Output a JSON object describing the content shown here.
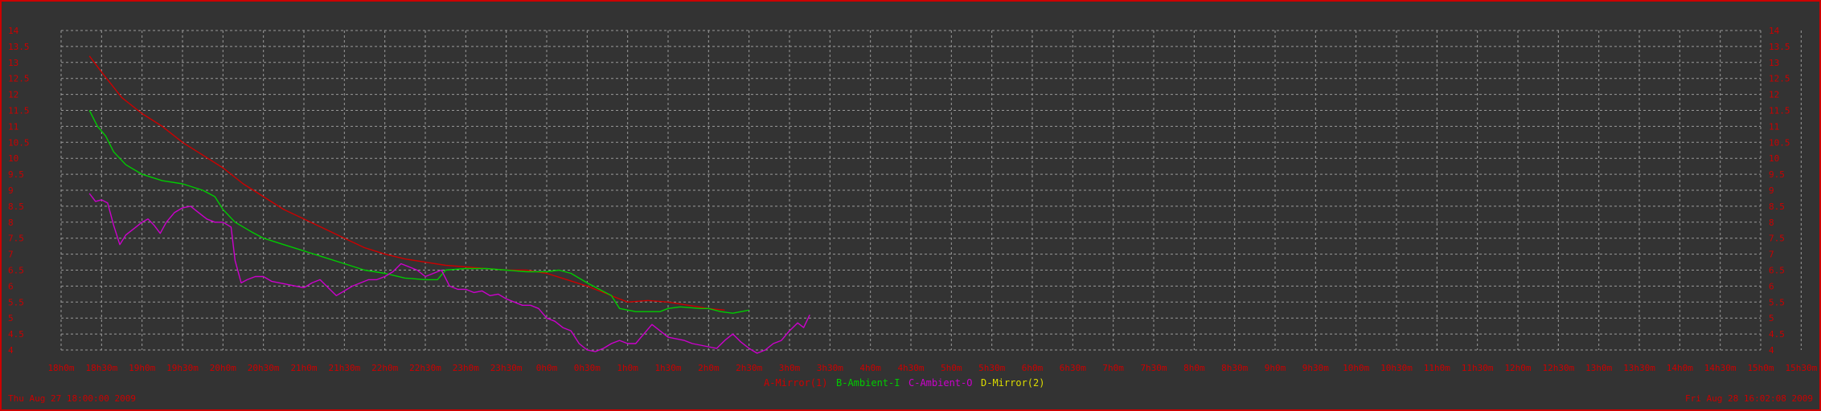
{
  "colors": {
    "background": "#333333",
    "border": "#cc0000",
    "grid": "#9a9a9a",
    "axis_text": "#cc0000"
  },
  "chart_data": {
    "type": "line",
    "grid": true,
    "legend_placement": "bottom-center",
    "ylim": [
      4,
      14
    ],
    "yticks": [
      4,
      4.5,
      5,
      5.5,
      6,
      6.5,
      7,
      7.5,
      8,
      8.5,
      9,
      9.5,
      10,
      10.5,
      11,
      11.5,
      12,
      12.5,
      13,
      13.5,
      14
    ],
    "ytick_labels": [
      "4",
      "4.5",
      "5",
      "5.5",
      "6",
      "6.5",
      "7",
      "7.5",
      "8",
      "8.5",
      "9",
      "9.5",
      "10",
      "10.5",
      "11",
      "11.5",
      "12",
      "12.5",
      "13",
      "13.5",
      "14"
    ],
    "xlim": [
      0,
      42
    ],
    "xtick_labels": [
      "18h0m",
      "18h30m",
      "19h0m",
      "19h30m",
      "20h0m",
      "20h30m",
      "21h0m",
      "21h30m",
      "22h0m",
      "22h30m",
      "23h0m",
      "23h30m",
      "0h0m",
      "0h30m",
      "1h0m",
      "1h30m",
      "2h0m",
      "2h30m",
      "3h0m",
      "3h30m",
      "4h0m",
      "4h30m",
      "5h0m",
      "5h30m",
      "6h0m",
      "6h30m",
      "7h0m",
      "7h30m",
      "8h0m",
      "8h30m",
      "9h0m",
      "9h30m",
      "10h0m",
      "10h30m",
      "11h0m",
      "11h30m",
      "12h0m",
      "12h30m",
      "13h0m",
      "13h30m",
      "14h0m",
      "14h30m",
      "15h0m",
      "15h30m",
      "16h0m"
    ],
    "series": [
      {
        "name": "A-Mirror(1)",
        "color": "#cc0000",
        "points": [
          [
            0.7,
            13.2
          ],
          [
            1.0,
            12.7
          ],
          [
            1.5,
            11.9
          ],
          [
            2.0,
            11.4
          ],
          [
            2.5,
            11.0
          ],
          [
            3.0,
            10.5
          ],
          [
            3.5,
            10.1
          ],
          [
            4.0,
            9.7
          ],
          [
            4.5,
            9.2
          ],
          [
            5.0,
            8.8
          ],
          [
            5.5,
            8.4
          ],
          [
            6.0,
            8.1
          ],
          [
            6.5,
            7.8
          ],
          [
            7.0,
            7.5
          ],
          [
            7.5,
            7.2
          ],
          [
            8.0,
            7.0
          ],
          [
            8.5,
            6.85
          ],
          [
            9.0,
            6.75
          ],
          [
            9.5,
            6.65
          ],
          [
            10.0,
            6.6
          ],
          [
            10.5,
            6.55
          ],
          [
            11.0,
            6.5
          ],
          [
            11.5,
            6.5
          ],
          [
            12.0,
            6.4
          ],
          [
            12.5,
            6.2
          ],
          [
            13.0,
            6.0
          ],
          [
            13.5,
            5.75
          ],
          [
            14.0,
            5.5
          ],
          [
            14.5,
            5.55
          ],
          [
            15.0,
            5.5
          ],
          [
            15.5,
            5.4
          ],
          [
            16.0,
            5.3
          ],
          [
            16.4,
            5.25
          ]
        ]
      },
      {
        "name": "B-Ambient-I",
        "color": "#00cc00",
        "points": [
          [
            0.7,
            11.5
          ],
          [
            0.9,
            11.0
          ],
          [
            1.1,
            10.7
          ],
          [
            1.3,
            10.2
          ],
          [
            1.6,
            9.8
          ],
          [
            2.0,
            9.5
          ],
          [
            2.5,
            9.3
          ],
          [
            3.0,
            9.2
          ],
          [
            3.5,
            9.0
          ],
          [
            3.8,
            8.8
          ],
          [
            4.0,
            8.4
          ],
          [
            4.3,
            8.0
          ],
          [
            4.7,
            7.7
          ],
          [
            5.0,
            7.5
          ],
          [
            5.5,
            7.3
          ],
          [
            6.0,
            7.1
          ],
          [
            6.5,
            6.9
          ],
          [
            7.0,
            6.7
          ],
          [
            7.5,
            6.5
          ],
          [
            8.0,
            6.4
          ],
          [
            8.5,
            6.25
          ],
          [
            9.0,
            6.2
          ],
          [
            9.3,
            6.2
          ],
          [
            9.5,
            6.5
          ],
          [
            10.0,
            6.55
          ],
          [
            10.5,
            6.55
          ],
          [
            11.0,
            6.5
          ],
          [
            11.5,
            6.45
          ],
          [
            12.0,
            6.45
          ],
          [
            12.3,
            6.5
          ],
          [
            12.6,
            6.4
          ],
          [
            13.0,
            6.1
          ],
          [
            13.3,
            5.9
          ],
          [
            13.6,
            5.7
          ],
          [
            13.8,
            5.3
          ],
          [
            14.2,
            5.2
          ],
          [
            14.8,
            5.2
          ],
          [
            15.0,
            5.3
          ],
          [
            15.3,
            5.35
          ],
          [
            15.8,
            5.3
          ],
          [
            16.0,
            5.3
          ],
          [
            16.3,
            5.2
          ],
          [
            16.6,
            5.15
          ],
          [
            17.0,
            5.25
          ]
        ]
      },
      {
        "name": "C-Ambient-O",
        "color": "#cc00cc",
        "points": [
          [
            0.7,
            8.9
          ],
          [
            0.85,
            8.65
          ],
          [
            1.0,
            8.7
          ],
          [
            1.15,
            8.6
          ],
          [
            1.3,
            7.9
          ],
          [
            1.45,
            7.3
          ],
          [
            1.6,
            7.6
          ],
          [
            1.8,
            7.8
          ],
          [
            2.0,
            8.0
          ],
          [
            2.15,
            8.1
          ],
          [
            2.3,
            7.9
          ],
          [
            2.45,
            7.65
          ],
          [
            2.6,
            8.0
          ],
          [
            2.8,
            8.3
          ],
          [
            3.0,
            8.45
          ],
          [
            3.2,
            8.5
          ],
          [
            3.4,
            8.3
          ],
          [
            3.6,
            8.1
          ],
          [
            3.8,
            8.0
          ],
          [
            4.0,
            8.0
          ],
          [
            4.2,
            7.85
          ],
          [
            4.3,
            6.8
          ],
          [
            4.45,
            6.1
          ],
          [
            4.6,
            6.2
          ],
          [
            4.8,
            6.3
          ],
          [
            5.0,
            6.3
          ],
          [
            5.2,
            6.15
          ],
          [
            5.4,
            6.1
          ],
          [
            5.6,
            6.05
          ],
          [
            5.8,
            6.0
          ],
          [
            6.0,
            5.95
          ],
          [
            6.2,
            6.1
          ],
          [
            6.4,
            6.2
          ],
          [
            6.6,
            5.95
          ],
          [
            6.8,
            5.7
          ],
          [
            7.0,
            5.85
          ],
          [
            7.2,
            6.0
          ],
          [
            7.4,
            6.1
          ],
          [
            7.6,
            6.2
          ],
          [
            7.8,
            6.2
          ],
          [
            8.0,
            6.3
          ],
          [
            8.2,
            6.45
          ],
          [
            8.4,
            6.7
          ],
          [
            8.6,
            6.6
          ],
          [
            8.8,
            6.5
          ],
          [
            9.0,
            6.3
          ],
          [
            9.2,
            6.4
          ],
          [
            9.4,
            6.5
          ],
          [
            9.6,
            6.0
          ],
          [
            9.8,
            5.9
          ],
          [
            10.0,
            5.9
          ],
          [
            10.2,
            5.8
          ],
          [
            10.4,
            5.85
          ],
          [
            10.6,
            5.7
          ],
          [
            10.8,
            5.75
          ],
          [
            11.0,
            5.6
          ],
          [
            11.2,
            5.5
          ],
          [
            11.4,
            5.4
          ],
          [
            11.6,
            5.4
          ],
          [
            11.8,
            5.3
          ],
          [
            12.0,
            5.0
          ],
          [
            12.2,
            4.9
          ],
          [
            12.4,
            4.7
          ],
          [
            12.6,
            4.6
          ],
          [
            12.8,
            4.2
          ],
          [
            13.0,
            4.0
          ],
          [
            13.2,
            3.95
          ],
          [
            13.4,
            4.05
          ],
          [
            13.6,
            4.2
          ],
          [
            13.8,
            4.3
          ],
          [
            14.0,
            4.2
          ],
          [
            14.2,
            4.2
          ],
          [
            14.4,
            4.5
          ],
          [
            14.6,
            4.8
          ],
          [
            14.8,
            4.6
          ],
          [
            15.0,
            4.4
          ],
          [
            15.2,
            4.35
          ],
          [
            15.4,
            4.3
          ],
          [
            15.6,
            4.2
          ],
          [
            15.8,
            4.15
          ],
          [
            16.0,
            4.1
          ],
          [
            16.2,
            4.05
          ],
          [
            16.4,
            4.3
          ],
          [
            16.6,
            4.5
          ],
          [
            16.8,
            4.25
          ],
          [
            17.0,
            4.05
          ],
          [
            17.2,
            3.9
          ],
          [
            17.4,
            4.0
          ],
          [
            17.6,
            4.2
          ],
          [
            17.8,
            4.3
          ],
          [
            18.0,
            4.6
          ],
          [
            18.2,
            4.85
          ],
          [
            18.35,
            4.7
          ],
          [
            18.5,
            5.1
          ]
        ]
      },
      {
        "name": "D-Mirror(2)",
        "color": "#dddd00",
        "points": []
      }
    ],
    "start_label": "Thu Aug 27 18:00:00 2009",
    "end_label": "Fri Aug 28 16:02:08 2009"
  }
}
